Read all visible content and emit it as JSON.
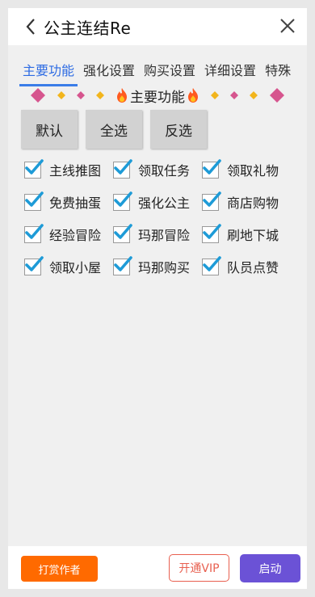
{
  "header": {
    "title": "公主连结Re"
  },
  "tabs": [
    {
      "label": "主要功能"
    },
    {
      "label": "强化设置"
    },
    {
      "label": "购买设置"
    },
    {
      "label": "详细设置"
    },
    {
      "label": "特殊"
    }
  ],
  "section": {
    "title": "主要功能"
  },
  "buttons": {
    "default": "默认",
    "select_all": "全选",
    "invert": "反选"
  },
  "checks": [
    {
      "label": "主线推图",
      "checked": true
    },
    {
      "label": "领取任务",
      "checked": true
    },
    {
      "label": "领取礼物",
      "checked": true
    },
    {
      "label": "免费抽蛋",
      "checked": true
    },
    {
      "label": "强化公主",
      "checked": true
    },
    {
      "label": "商店购物",
      "checked": true
    },
    {
      "label": "经验冒险",
      "checked": true
    },
    {
      "label": "玛那冒险",
      "checked": true
    },
    {
      "label": "刷地下城",
      "checked": true
    },
    {
      "label": "领取小屋",
      "checked": true
    },
    {
      "label": "玛那购买",
      "checked": true
    },
    {
      "label": "队员点赞",
      "checked": true
    }
  ],
  "footer": {
    "reward": "打赏作者",
    "vip": "开通VIP",
    "start": "启动"
  },
  "colors": {
    "accent_tab": "#2d6be3",
    "check": "#1e9bd7",
    "reward": "#ff6a00",
    "vip": "#e86050",
    "start": "#6b52d6"
  },
  "icons": [
    "back-arrow-icon",
    "close-icon",
    "diamond-icon",
    "fire-icon",
    "checkmark-icon"
  ]
}
